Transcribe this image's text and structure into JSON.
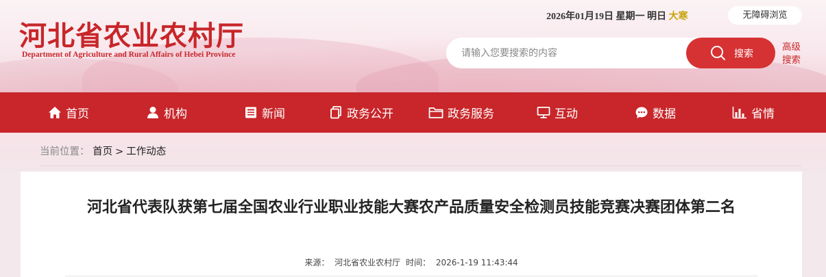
{
  "header": {
    "logo_cn": "河北省农业农村厅",
    "logo_en": "Department of  Agriculture and  Rural Affairs  of Hebei Province",
    "date": "2026年01月19日 星期一 明日",
    "solar_term": "大寒",
    "accessibility_label": "无障碍浏览",
    "search_placeholder": "请输入您要搜索的内容",
    "search_button_label": "搜索",
    "advanced_search_line1": "高级",
    "advanced_search_line2": "搜索"
  },
  "nav": {
    "items": [
      {
        "label": "首页",
        "icon": "home-icon"
      },
      {
        "label": "机构",
        "icon": "user-icon"
      },
      {
        "label": "新闻",
        "icon": "news-icon"
      },
      {
        "label": "政务公开",
        "icon": "documents-icon"
      },
      {
        "label": "政务服务",
        "icon": "folder-icon"
      },
      {
        "label": "互动",
        "icon": "monitor-icon"
      },
      {
        "label": "数据",
        "icon": "chat-icon"
      },
      {
        "label": "省情",
        "icon": "bar-chart-icon"
      }
    ]
  },
  "breadcrumb": {
    "lead": "当前位置：",
    "home": "首页",
    "separator": ">",
    "current": "工作动态"
  },
  "article": {
    "title": "河北省代表队获第七届全国农业行业职业技能大赛农产品质量安全检测员技能竞赛决赛团体第二名",
    "source_label": "来源：",
    "source": "河北省农业农村厅",
    "time_label": "时间：",
    "time": "2026-1-19 11:43:44"
  },
  "colors": {
    "brand_red": "#c8262a",
    "solar_term": "#c8a20b",
    "search_button": "#d63233"
  }
}
